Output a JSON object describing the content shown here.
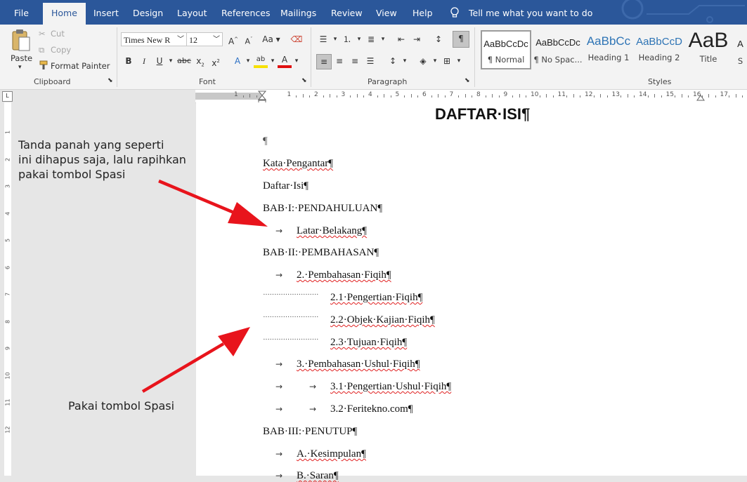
{
  "tabs": [
    "File",
    "Home",
    "Insert",
    "Design",
    "Layout",
    "References",
    "Mailings",
    "Review",
    "View",
    "Help"
  ],
  "tell_me": "Tell me what you want to do",
  "clipboard": {
    "paste": "Paste",
    "cut": "Cut",
    "copy": "Copy",
    "format_painter": "Format Painter",
    "label": "Clipboard"
  },
  "font": {
    "name": "Times New R",
    "size": "12",
    "label": "Font"
  },
  "paragraph": {
    "label": "Paragraph"
  },
  "styles": {
    "label": "Styles",
    "items": [
      {
        "preview": "AaBbCcDc",
        "name": "¶ Normal"
      },
      {
        "preview": "AaBbCcDc",
        "name": "¶ No Spac..."
      },
      {
        "preview": "AaBbCc",
        "name": "Heading 1"
      },
      {
        "preview": "AaBbCcD",
        "name": "Heading 2"
      },
      {
        "preview": "AaB",
        "name": "Title"
      },
      {
        "preview": "A",
        "name": "S"
      }
    ]
  },
  "ruler_numbers": [
    "1",
    "1",
    "2",
    "3",
    "4",
    "5",
    "6",
    "7",
    "8",
    "9",
    "10",
    "11",
    "12",
    "13",
    "14",
    "15",
    "16",
    "17",
    "18"
  ],
  "left_ruler_numbers": [
    "1",
    "2",
    "3",
    "4",
    "5",
    "6",
    "7",
    "8",
    "9",
    "10",
    "11",
    "12"
  ],
  "document": {
    "title": "DAFTAR·ISI¶",
    "empty_para": "¶",
    "kata_pengantar": "Kata·Pengantar¶",
    "daftar_isi": "Daftar·Isi¶",
    "bab1": "BAB·I:·PENDAHULUAN¶",
    "latar": "Latar·Belakang¶",
    "bab2": "BAB·II:·PEMBAHASAN¶",
    "item2": "2.·Pembahasan·Fiqih¶",
    "item21": "2.1·Pengertian·Fiqih¶",
    "item22": "2.2·Objek·Kajian·Fiqih¶",
    "item23": "2.3·Tujuan·Fiqih¶",
    "item3": "3.·Pembahasan·Ushul·Fiqih¶",
    "item31": "3.1·Pengertian·Ushul·Fiqih¶",
    "item32": "3.2·Feritekno.com¶",
    "bab3": "BAB·III:·PENUTUP¶",
    "kesimpulan": "A.·Kesimpulan¶",
    "saran": "B.·Saran¶",
    "tab_arrow": "→",
    "dots": "·························"
  },
  "annotations": {
    "note1_l1": "Tanda panah yang seperti",
    "note1_l2": "ini dihapus saja, lalu rapihkan",
    "note1_l3": "pakai tombol Spasi",
    "note2": "Pakai tombol Spasi",
    "arrow_color": "#e8141c"
  },
  "colors": {
    "brand": "#2b579a"
  }
}
